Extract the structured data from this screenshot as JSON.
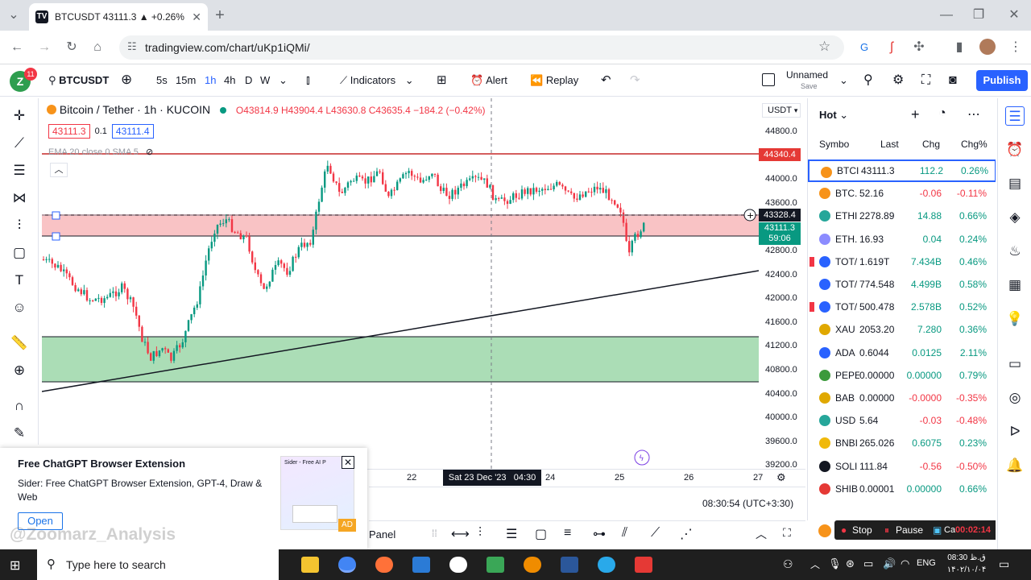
{
  "browser": {
    "tab_title": "BTCUSDT 43111.3 ▲ +0.26% U...",
    "url": "tradingview.com/chart/uKp1iQMi/",
    "new_tab": "+"
  },
  "toolbar": {
    "badge": "11",
    "avatar_letter": "Z",
    "symbol": "BTCUSDT",
    "intervals": [
      "5s",
      "15m",
      "1h",
      "4h",
      "D",
      "W"
    ],
    "indicators_label": "Indicators",
    "alert_label": "Alert",
    "replay_label": "Replay",
    "layout_name": "Unnamed",
    "layout_sub": "Save",
    "publish_label": "Publish"
  },
  "chart": {
    "title": "Bitcoin / Tether · 1h · KUCOIN",
    "ohlc": "O43814.9 H43904.4 L43630.8 C43635.4 −184.2 (−0.42%)",
    "bid": "43111.3",
    "spread": "0.1",
    "ask": "43111.4",
    "ema_label": "EMA 20 close 0 SMA 5",
    "currency": "USDT",
    "price_ticks": [
      "44800.0",
      "44400.0",
      "44000.0",
      "43600.0",
      "42800.0",
      "42400.0",
      "42000.0",
      "41600.0",
      "41200.0",
      "40800.0",
      "40400.0",
      "40000.0",
      "39600.0",
      "39200.0"
    ],
    "tag_red_line": "44340.4",
    "tag_crosshair": "43328.4",
    "tag_last_price": "43111.3",
    "tag_countdown": "59:06",
    "time_ticks": [
      {
        "label": "22",
        "v": 22
      },
      {
        "label": "24",
        "v": 24
      },
      {
        "label": "25",
        "v": 25
      },
      {
        "label": "26",
        "v": 26
      },
      {
        "label": "27",
        "v": 27
      }
    ],
    "crosshair_time": "Sat 23 Dec '23   04:30",
    "clock": "08:30:54 (UTC+3:30)",
    "colors": {
      "up": "#089981",
      "down": "#f23645",
      "red_zone": "#f7a9ad",
      "green_zone": "#8fd19e"
    }
  },
  "bottom": {
    "panel_label": "Panel"
  },
  "watchlist": {
    "title": "Hot",
    "columns": [
      "Symbo",
      "Last",
      "Chg",
      "Chg%"
    ],
    "rows": [
      {
        "sym": "BTCI",
        "last": "43111.3",
        "chg": "112.2",
        "chgp": "0.26%",
        "color": "#f7931a",
        "dir": "pos",
        "flag": false
      },
      {
        "sym": "BTC.",
        "last": "52.16",
        "chg": "-0.06",
        "chgp": "-0.11%",
        "color": "#f7931a",
        "dir": "neg",
        "flag": false
      },
      {
        "sym": "ETHI",
        "last": "2278.89",
        "chg": "14.88",
        "chgp": "0.66%",
        "color": "#26a69a",
        "dir": "pos",
        "flag": false
      },
      {
        "sym": "ETH.",
        "last": "16.93",
        "chg": "0.04",
        "chgp": "0.24%",
        "color": "#8c8cff",
        "dir": "pos",
        "flag": false
      },
      {
        "sym": "TOT/",
        "last": "1.619T",
        "chg": "7.434B",
        "chgp": "0.46%",
        "color": "#2962ff",
        "dir": "pos",
        "flag": true
      },
      {
        "sym": "TOT/",
        "last": "774.548",
        "chg": "4.499B",
        "chgp": "0.58%",
        "color": "#2962ff",
        "dir": "pos",
        "flag": false
      },
      {
        "sym": "TOT/",
        "last": "500.478",
        "chg": "2.578B",
        "chgp": "0.52%",
        "color": "#2962ff",
        "dir": "pos",
        "flag": true
      },
      {
        "sym": "XAU",
        "last": "2053.20",
        "chg": "7.280",
        "chgp": "0.36%",
        "color": "#e0a800",
        "dir": "pos",
        "flag": false
      },
      {
        "sym": "ADA",
        "last": "0.6044",
        "chg": "0.0125",
        "chgp": "2.11%",
        "color": "#2962ff",
        "dir": "pos",
        "flag": false
      },
      {
        "sym": "PEPE",
        "last": "0.00000",
        "chg": "0.00000",
        "chgp": "0.79%",
        "color": "#3c9a3c",
        "dir": "pos",
        "flag": false
      },
      {
        "sym": "BAB",
        "last": "0.00000",
        "chg": "-0.0000",
        "chgp": "-0.35%",
        "color": "#e0a800",
        "dir": "neg",
        "flag": false
      },
      {
        "sym": "USD",
        "last": "5.64",
        "chg": "-0.03",
        "chgp": "-0.48%",
        "color": "#26a69a",
        "dir": "neg",
        "flag": false
      },
      {
        "sym": "BNBI",
        "last": "265.026",
        "chg": "0.6075",
        "chgp": "0.23%",
        "color": "#f0b90b",
        "dir": "pos",
        "flag": false
      },
      {
        "sym": "SOLI",
        "last": "111.84",
        "chg": "-0.56",
        "chgp": "-0.50%",
        "color": "#131722",
        "dir": "neg",
        "flag": false
      },
      {
        "sym": "SHIB",
        "last": "0.00001",
        "chg": "0.00000",
        "chgp": "0.66%",
        "color": "#e53935",
        "dir": "pos",
        "flag": false
      }
    ]
  },
  "popup": {
    "title": "Free ChatGPT Browser Extension",
    "body": "Sider: Free ChatGPT Browser Extension, GPT-4, Draw & Web",
    "open_label": "Open",
    "ad_label": "AD",
    "thumb_title": "Sider - Free AI P",
    "watermark": "@Zoomarz_Analysis"
  },
  "recorder": {
    "stop": "Stop",
    "pause": "Pause",
    "capture": "Capture",
    "timer": "00:02:14"
  },
  "taskbar": {
    "search_placeholder": "Type here to search",
    "lang": "ENG",
    "time": "08:30 ق.ظ",
    "date": "۱۴۰۲/۱۰/۰۴"
  }
}
